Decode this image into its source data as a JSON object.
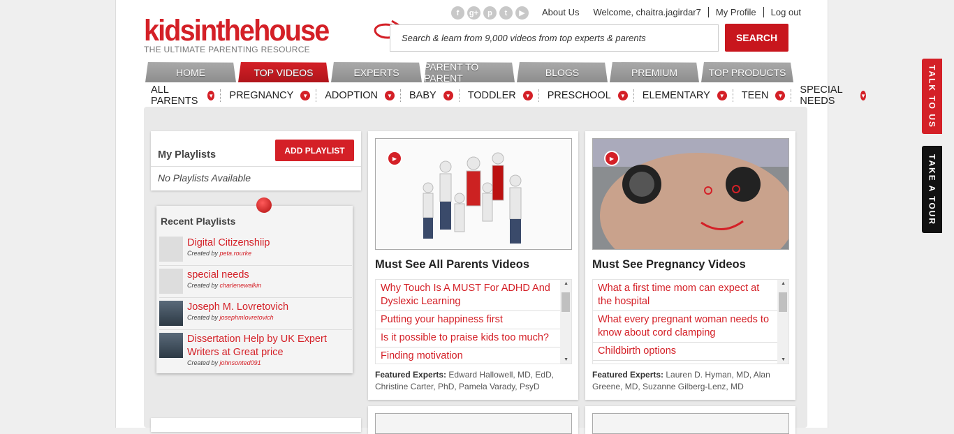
{
  "logo": {
    "name": "kidsinthehouse",
    "tagline": "THE ULTIMATE PARENTING RESOURCE"
  },
  "social_icons": [
    "facebook-icon",
    "google-plus-icon",
    "pinterest-icon",
    "twitter-icon",
    "youtube-icon"
  ],
  "top_links": {
    "about": "About Us",
    "welcome": "Welcome, chaitra.jagirdar7",
    "profile": "My Profile",
    "logout": "Log out"
  },
  "search": {
    "placeholder": "Search & learn from 9,000 videos from top experts & parents",
    "button": "SEARCH"
  },
  "tabs": [
    "HOME",
    "TOP VIDEOS",
    "EXPERTS",
    "PARENT TO PARENT",
    "BLOGS",
    "PREMIUM",
    "TOP PRODUCTS"
  ],
  "active_tab": "TOP VIDEOS",
  "subnav": [
    "ALL PARENTS",
    "PREGNANCY",
    "ADOPTION",
    "BABY",
    "TODDLER",
    "PRESCHOOL",
    "ELEMENTARY",
    "TEEN",
    "SPECIAL NEEDS"
  ],
  "my_playlists": {
    "title": "My Playlists",
    "add_button": "ADD PLAYLIST",
    "empty": "No Playlists Available"
  },
  "recent_playlists": {
    "title": "Recent Playlists",
    "items": [
      {
        "title": "Digital Citizenshiip",
        "by_label": "Created by",
        "author": "peta.rourke"
      },
      {
        "title": "special needs",
        "by_label": "Created by",
        "author": "charlenewalkin"
      },
      {
        "title": "Joseph M. Lovretovich",
        "by_label": "Created by",
        "author": "josephmlovretovich"
      },
      {
        "title": "Dissertation Help by UK Expert Writers at Great price",
        "by_label": "Created by",
        "author": "johnsonted091"
      }
    ]
  },
  "cards": [
    {
      "title": "Must See All Parents Videos",
      "videos": [
        "Why Touch Is A MUST For ADHD And Dyslexic Learning",
        "Putting your happiness first",
        "Is it possible to praise kids too much?",
        "Finding motivation"
      ],
      "featured_label": "Featured Experts:",
      "experts": "Edward Hallowell, MD, EdD, Christine Carter, PhD, Pamela Varady, PsyD"
    },
    {
      "title": "Must See Pregnancy Videos",
      "videos": [
        "What a first time mom can expect at the hospital",
        "What every pregnant woman needs to know about cord clamping",
        "Childbirth options"
      ],
      "featured_label": "Featured Experts:",
      "experts": "Lauren D. Hyman, MD, Alan Greene, MD, Suzanne Gilberg-Lenz, MD"
    }
  ],
  "side_tabs": {
    "talk": "TALK TO US",
    "tour": "TAKE A TOUR"
  },
  "colors": {
    "brand_red": "#d42027",
    "tab_gray": "#9a9a9a"
  }
}
